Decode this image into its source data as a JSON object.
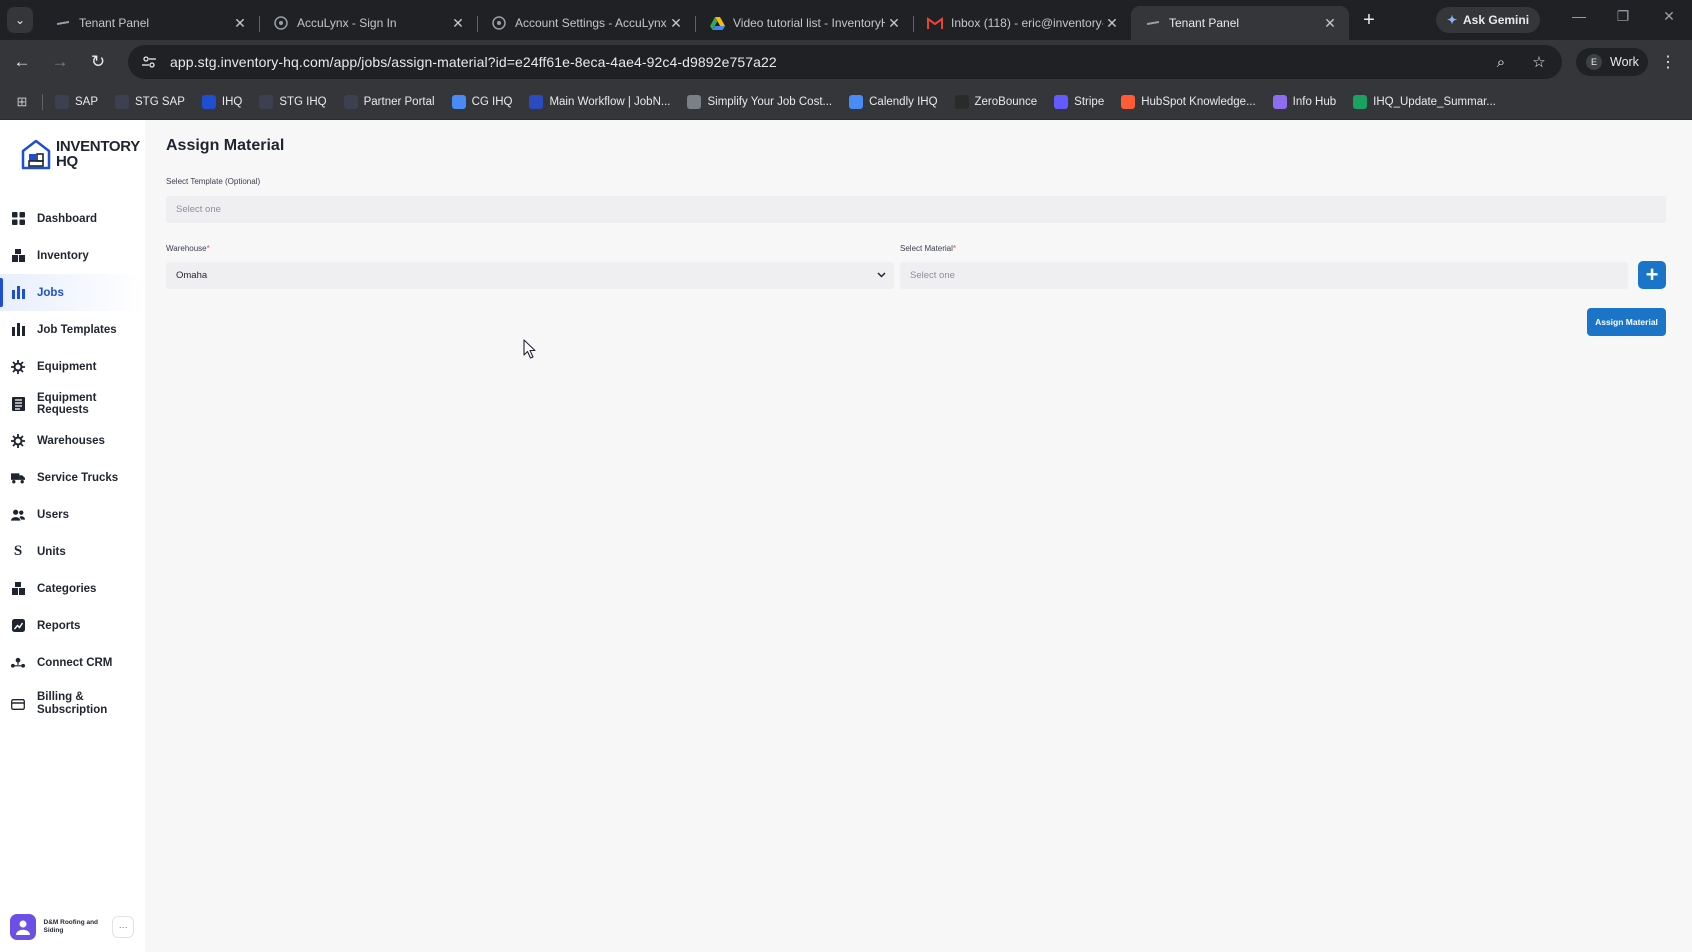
{
  "browser": {
    "tabs": [
      {
        "title": "Tenant Panel",
        "icon": "ihq-favicon",
        "active": false
      },
      {
        "title": "AccuLynx - Sign In",
        "icon": "acculynx-favicon",
        "active": false
      },
      {
        "title": "Account Settings - AccuLynx",
        "icon": "acculynx-favicon",
        "active": false
      },
      {
        "title": "Video tutorial list - InventoryH",
        "icon": "google-drive-favicon",
        "active": false
      },
      {
        "title": "Inbox (118) - eric@inventory-h",
        "icon": "gmail-favicon",
        "active": false
      },
      {
        "title": "Tenant Panel",
        "icon": "ihq-favicon",
        "active": true
      }
    ],
    "ask_gemini": "Ask Gemini",
    "url": "app.stg.inventory-hq.com/app/jobs/assign-material?id=e24ff61e-8eca-4ae4-92c4-d9892e757a22",
    "profile": {
      "initial": "E",
      "name": "Work"
    },
    "bookmarks": [
      {
        "label": "SAP",
        "color": "#3b4150"
      },
      {
        "label": "STG SAP",
        "color": "#3b4150"
      },
      {
        "label": "IHQ",
        "color": "#1e4fd1"
      },
      {
        "label": "STG IHQ",
        "color": "#3b4150"
      },
      {
        "label": "Partner Portal",
        "color": "#3b4150"
      },
      {
        "label": "CG IHQ",
        "color": "#4a8af4"
      },
      {
        "label": "Main Workflow | JobN...",
        "color": "#2b4cc0"
      },
      {
        "label": "Simplify Your Job Cost...",
        "color": "#7a7f88"
      },
      {
        "label": "Calendly IHQ",
        "color": "#4a8af4"
      },
      {
        "label": "ZeroBounce",
        "color": "#2a2a2a"
      },
      {
        "label": "Stripe",
        "color": "#635bff"
      },
      {
        "label": "HubSpot Knowledge...",
        "color": "#ff5c35"
      },
      {
        "label": "Info Hub",
        "color": "#8e6cf0"
      },
      {
        "label": "IHQ_Update_Summar...",
        "color": "#1aa260"
      }
    ]
  },
  "app": {
    "logo": {
      "line1": "INVENTORY",
      "line2": "HQ"
    },
    "sidebar": {
      "items": [
        {
          "label": "Dashboard",
          "icon": "dashboard-icon",
          "active": false
        },
        {
          "label": "Inventory",
          "icon": "inventory-icon",
          "active": false
        },
        {
          "label": "Jobs",
          "icon": "jobs-icon",
          "active": true
        },
        {
          "label": "Job Templates",
          "icon": "job-templates-icon",
          "active": false
        },
        {
          "label": "Equipment",
          "icon": "equipment-icon",
          "active": false
        },
        {
          "label": "Equipment Requests",
          "icon": "equipment-requests-icon",
          "active": false
        },
        {
          "label": "Warehouses",
          "icon": "warehouses-icon",
          "active": false
        },
        {
          "label": "Service Trucks",
          "icon": "truck-icon",
          "active": false
        },
        {
          "label": "Users",
          "icon": "users-icon",
          "active": false
        },
        {
          "label": "Units",
          "icon": "units-icon",
          "active": false
        },
        {
          "label": "Categories",
          "icon": "categories-icon",
          "active": false
        },
        {
          "label": "Reports",
          "icon": "reports-icon",
          "active": false
        },
        {
          "label": "Connect CRM",
          "icon": "connect-crm-icon",
          "active": false
        },
        {
          "label": "Billing & Subscription",
          "icon": "billing-icon",
          "active": false
        }
      ],
      "org_name": "D&M Roofing and Siding",
      "more": "···"
    },
    "page": {
      "title": "Assign Material",
      "template": {
        "label": "Select Template (Optional)",
        "placeholder": "Select one"
      },
      "warehouse": {
        "label": "Warehouse",
        "required_mark": "*",
        "value": "Omaha"
      },
      "material": {
        "label": "Select Material",
        "required_mark": "*",
        "placeholder": "Select one"
      },
      "add_button": "+",
      "assign_button": "Assign Material"
    },
    "colors": {
      "primary": "#1a74c7",
      "nav_active": "#1e4fd1",
      "required": "#e5484d"
    }
  }
}
